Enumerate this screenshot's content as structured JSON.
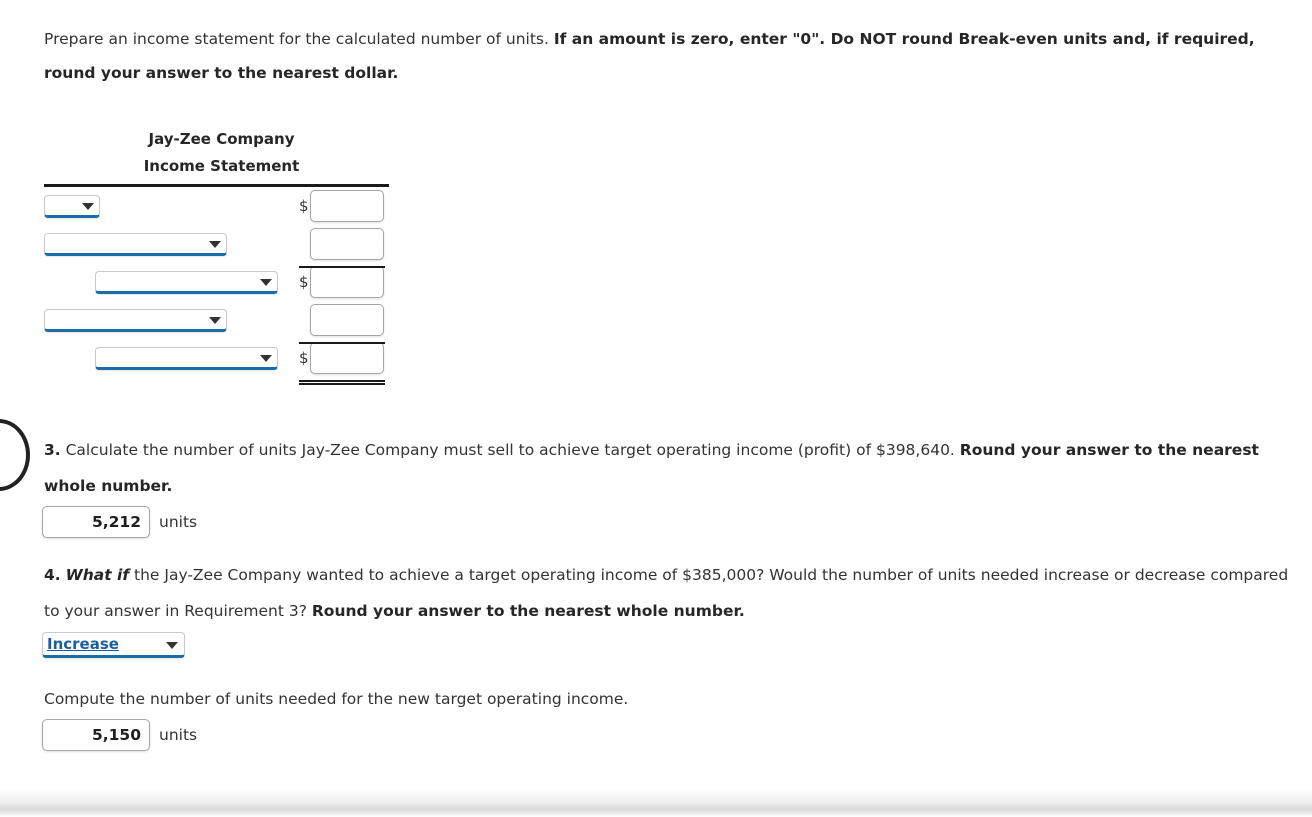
{
  "prompt": {
    "part1": "Prepare an income statement for the calculated number of units. ",
    "part2_bold": "If an amount is zero, enter \"0\". Do NOT round Break-even units and, if required, round your answer to the nearest dollar."
  },
  "statement": {
    "company": "Jay-Zee Company",
    "title": "Income Statement",
    "rows": [
      {
        "label": "",
        "indent": 0,
        "select_width": "w-sm",
        "dollar": "$",
        "amount": "",
        "rule": "none"
      },
      {
        "label": "",
        "indent": 0,
        "select_width": "w-lg",
        "dollar": "",
        "amount": "",
        "rule": "single"
      },
      {
        "label": "",
        "indent": 1,
        "select_width": "w-lg",
        "dollar": "$",
        "amount": "",
        "rule": "none"
      },
      {
        "label": "",
        "indent": 0,
        "select_width": "w-lg",
        "dollar": "",
        "amount": "",
        "rule": "single"
      },
      {
        "label": "",
        "indent": 1,
        "select_width": "w-lg",
        "dollar": "$",
        "amount": "",
        "rule": "double"
      }
    ]
  },
  "question3": {
    "number": "3.",
    "text_a": " Calculate the number of units Jay-Zee Company must sell to achieve target operating income (profit) of $398,640. ",
    "text_b_bold": "Round your answer to the nearest whole number.",
    "answer_value": "5,212",
    "answer_units": "units"
  },
  "question4": {
    "number": "4.",
    "emphasis": "What if",
    "text_a": " the Jay-Zee Company wanted to achieve a target operating income of $385,000? Would the number of units needed increase or decrease compared to your answer in Requirement 3? ",
    "text_b_bold": "Round your answer to the nearest whole number.",
    "direction_value": "Increase",
    "compute_text": "Compute the number of units needed for the new target operating income.",
    "answer_value": "5,150",
    "answer_units": "units"
  },
  "colors": {
    "select_underline": "#1b6ca8",
    "link_text": "#1b5e9e",
    "rule": "#1a1a1a"
  }
}
